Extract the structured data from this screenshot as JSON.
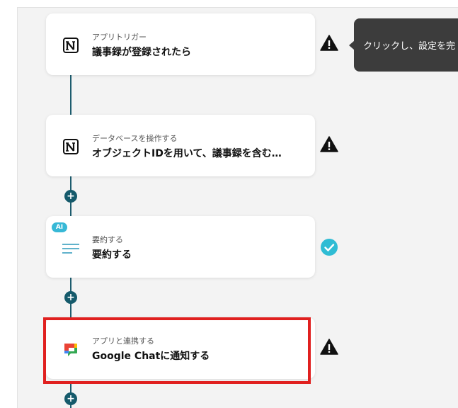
{
  "flow": {
    "steps": [
      {
        "subtitle": "アプリトリガー",
        "title": "議事録が登録されたら",
        "app_icon": "notion-icon",
        "status": "warning"
      },
      {
        "subtitle": "データベースを操作する",
        "title": "オブジェクトIDを用いて、議事録を含む…",
        "app_icon": "notion-icon",
        "status": "warning"
      },
      {
        "subtitle": "要約する",
        "title": "要約する",
        "app_icon": "summary-lines-icon",
        "badge": "AI",
        "status": "done"
      },
      {
        "subtitle": "アプリと連携する",
        "title": "Google Chatに通知する",
        "app_icon": "google-chat-icon",
        "status": "warning"
      }
    ]
  },
  "tooltip": {
    "text": "クリックし、設定を完"
  },
  "colors": {
    "connector": "#1d5c6e",
    "warning": "#111111",
    "done": "#2fbcd4",
    "highlight": "#e0201f",
    "ai_badge": "#37b8d6"
  }
}
